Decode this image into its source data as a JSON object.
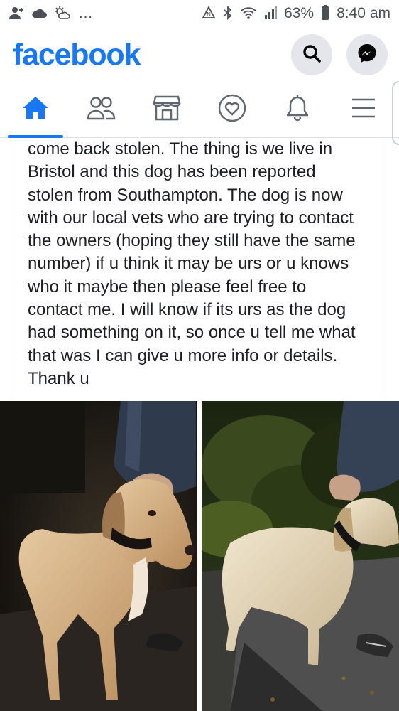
{
  "status_bar": {
    "battery": "63%",
    "time": "8:40 am",
    "icons": [
      "person-add-icon",
      "cloud-icon",
      "weather-icon",
      "more-icon",
      "nfc-icon",
      "bluetooth-icon",
      "wifi-icon",
      "signal-icon",
      "battery-icon"
    ],
    "overflow": "…"
  },
  "header": {
    "brand": "facebook",
    "actions": [
      "search-icon",
      "messenger-icon"
    ]
  },
  "nav": {
    "tabs": [
      {
        "name": "home",
        "icon": "home-icon",
        "active": true
      },
      {
        "name": "friends",
        "icon": "friends-icon",
        "active": false
      },
      {
        "name": "marketplace",
        "icon": "marketplace-icon",
        "active": false
      },
      {
        "name": "dating",
        "icon": "dating-icon",
        "active": false
      },
      {
        "name": "notifications",
        "icon": "bell-icon",
        "active": false
      },
      {
        "name": "menu",
        "icon": "menu-icon",
        "active": false
      }
    ],
    "accent": "#1877f2"
  },
  "post": {
    "lines": [
      "come back stolen. The thing is we live in",
      "Bristol and this dog has been reported",
      "stolen from Southampton. The dog is now",
      "with our local vets who are trying to contact",
      "the owners (hoping they still have the same",
      "number) if u think it may be urs or u knows",
      "who it maybe then please feel free to",
      "contact me. I will know if its urs as the dog",
      "had something on it, so once u tell me what",
      "that was I can give u more info or details.",
      "Thank u"
    ],
    "photos": [
      "dog-photo-left",
      "dog-photo-right"
    ]
  }
}
